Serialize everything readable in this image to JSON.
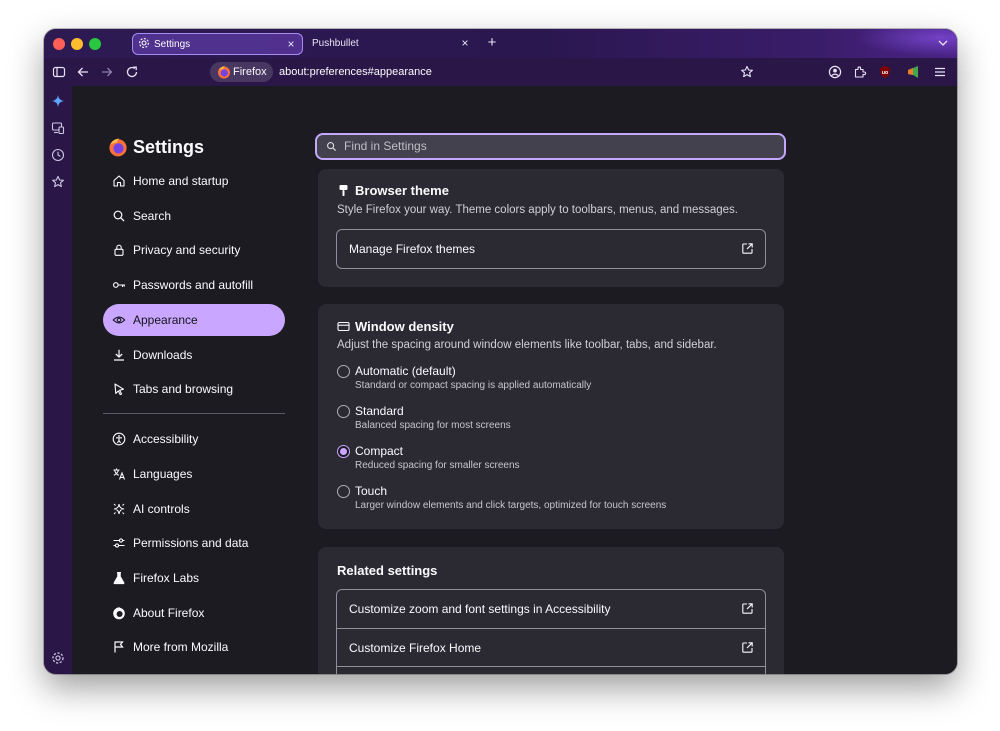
{
  "tabs": [
    {
      "label": "Settings",
      "active": true,
      "icon": "gear-icon"
    },
    {
      "label": "Pushbullet",
      "active": false
    }
  ],
  "navbar": {
    "identity_label": "Firefox",
    "url": "about:preferences#appearance"
  },
  "sidebar_icons": [
    "sparkle-icon",
    "synced-tabs-icon",
    "history-icon",
    "bookmarks-icon",
    "settings-icon"
  ],
  "settings": {
    "title": "Settings",
    "categories": [
      {
        "label": "Home and startup",
        "icon": "home-icon"
      },
      {
        "label": "Search",
        "icon": "search-icon"
      },
      {
        "label": "Privacy and security",
        "icon": "lock-icon"
      },
      {
        "label": "Passwords and autofill",
        "icon": "key-icon"
      },
      {
        "label": "Appearance",
        "icon": "eye-icon",
        "selected": true
      },
      {
        "label": "Downloads",
        "icon": "download-icon"
      },
      {
        "label": "Tabs and browsing",
        "icon": "cursor-icon"
      },
      {
        "label": "Accessibility",
        "icon": "accessibility-icon"
      },
      {
        "label": "Languages",
        "icon": "translate-icon"
      },
      {
        "label": "AI controls",
        "icon": "ai-sparkle-icon"
      },
      {
        "label": "Permissions and data",
        "icon": "sliders-icon"
      },
      {
        "label": "Firefox Labs",
        "icon": "flask-icon"
      },
      {
        "label": "About Firefox",
        "icon": "firefox-icon"
      },
      {
        "label": "More from Mozilla",
        "icon": "mozilla-icon"
      }
    ]
  },
  "search": {
    "placeholder": "Find in Settings"
  },
  "browser_theme": {
    "title": "Browser theme",
    "description": "Style Firefox your way. Theme colors apply to toolbars, menus, and messages.",
    "button_label": "Manage Firefox themes"
  },
  "window_density": {
    "title": "Window density",
    "description": "Adjust the spacing around window elements like toolbar, tabs, and sidebar.",
    "options": [
      {
        "label": "Automatic (default)",
        "description": "Standard or compact spacing is applied automatically",
        "checked": false
      },
      {
        "label": "Standard",
        "description": "Balanced spacing for most screens",
        "checked": false
      },
      {
        "label": "Compact",
        "description": "Reduced spacing for smaller screens",
        "checked": true
      },
      {
        "label": "Touch",
        "description": "Larger window elements and click targets, optimized for touch screens",
        "checked": false
      }
    ]
  },
  "related_settings": {
    "title": "Related settings",
    "items": [
      {
        "label": "Customize zoom and font settings in Accessibility"
      },
      {
        "label": "Customize Firefox Home"
      }
    ]
  },
  "colors": {
    "accent": "#c9a6ff",
    "chrome": "#2a1748",
    "content_bg": "#1c1b22",
    "card_bg": "#2b2a33"
  }
}
